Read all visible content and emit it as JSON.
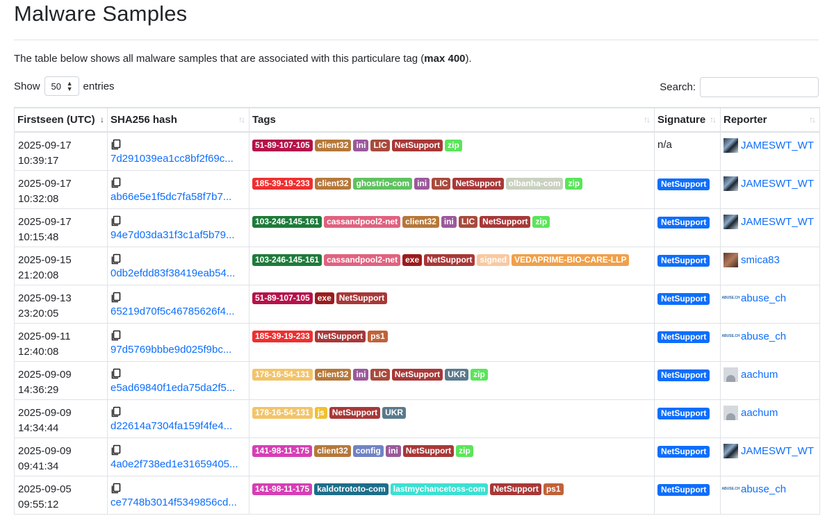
{
  "page": {
    "title": "Malware Samples",
    "intro_prefix": "The table below shows all malware samples that are associated with this particulare tag (",
    "intro_bold": "max 400",
    "intro_suffix": ")."
  },
  "controls": {
    "show_label": "Show",
    "entries_value": "50",
    "entries_label": "entries",
    "search_label": "Search:",
    "search_value": ""
  },
  "table": {
    "headers": [
      "Firstseen (UTC)",
      "SHA256 hash",
      "Tags",
      "Signature",
      "Reporter"
    ],
    "rows": [
      {
        "date": "2025-09-17",
        "time": "10:39:17",
        "hash": "7d291039ea1cc8bf2f69c...",
        "tags": [
          {
            "label": "51-89-107-105",
            "color": "#b5124a"
          },
          {
            "label": "client32",
            "color": "#b6783a"
          },
          {
            "label": "ini",
            "color": "#9b599b"
          },
          {
            "label": "LIC",
            "color": "#a84b3c"
          },
          {
            "label": "NetSupport",
            "color": "#a83838"
          },
          {
            "label": "zip",
            "color": "#5ae55a"
          }
        ],
        "signature": "n/a",
        "reporter": "JAMESWT_WT",
        "avatar": "jamesswt"
      },
      {
        "date": "2025-09-17",
        "time": "10:32:08",
        "hash": "ab66e5e1f5dc7fa58f7b7...",
        "tags": [
          {
            "label": "185-39-19-233",
            "color": "#ef2f2f"
          },
          {
            "label": "client32",
            "color": "#b6783a"
          },
          {
            "label": "ghostrio-com",
            "color": "#5fc25f"
          },
          {
            "label": "ini",
            "color": "#9b599b"
          },
          {
            "label": "LIC",
            "color": "#a84b3c"
          },
          {
            "label": "NetSupport",
            "color": "#a83838"
          },
          {
            "label": "olbanha-com",
            "color": "#c9d1c0"
          },
          {
            "label": "zip",
            "color": "#5ae55a"
          }
        ],
        "signature": "NetSupport",
        "reporter": "JAMESWT_WT",
        "avatar": "jamesswt"
      },
      {
        "date": "2025-09-17",
        "time": "10:15:48",
        "hash": "94e7d03da31f3c1af5b79...",
        "tags": [
          {
            "label": "103-246-145-161",
            "color": "#1e7b3b"
          },
          {
            "label": "cassandpool2-net",
            "color": "#e0627f"
          },
          {
            "label": "client32",
            "color": "#b6783a"
          },
          {
            "label": "ini",
            "color": "#9b599b"
          },
          {
            "label": "LIC",
            "color": "#a84b3c"
          },
          {
            "label": "NetSupport",
            "color": "#a83838"
          },
          {
            "label": "zip",
            "color": "#5ae55a"
          }
        ],
        "signature": "NetSupport",
        "reporter": "JAMESWT_WT",
        "avatar": "jamesswt"
      },
      {
        "date": "2025-09-15",
        "time": "21:20:08",
        "hash": "0db2efdd83f38419eab54...",
        "tags": [
          {
            "label": "103-246-145-161",
            "color": "#1e7b3b"
          },
          {
            "label": "cassandpool2-net",
            "color": "#e0627f"
          },
          {
            "label": "exe",
            "color": "#9b1c1c"
          },
          {
            "label": "NetSupport",
            "color": "#a83838"
          },
          {
            "label": "signed",
            "color": "#f8c9a0"
          },
          {
            "label": "VEDAPRIME-BIO-CARE-LLP",
            "color": "#f0a04a"
          }
        ],
        "signature": "NetSupport",
        "reporter": "smica83",
        "avatar": "smica"
      },
      {
        "date": "2025-09-13",
        "time": "23:20:05",
        "hash": "65219d70f5c46785626f4...",
        "tags": [
          {
            "label": "51-89-107-105",
            "color": "#b5124a"
          },
          {
            "label": "exe",
            "color": "#9b1c1c"
          },
          {
            "label": "NetSupport",
            "color": "#a83838"
          }
        ],
        "signature": "NetSupport",
        "reporter": "abuse_ch",
        "avatar": "abuse"
      },
      {
        "date": "2025-09-11",
        "time": "12:40:08",
        "hash": "97d5769bbbe9d025f9bc...",
        "tags": [
          {
            "label": "185-39-19-233",
            "color": "#ef2f2f"
          },
          {
            "label": "NetSupport",
            "color": "#a83838"
          },
          {
            "label": "ps1",
            "color": "#c0623a"
          }
        ],
        "signature": "NetSupport",
        "reporter": "abuse_ch",
        "avatar": "abuse"
      },
      {
        "date": "2025-09-09",
        "time": "14:36:29",
        "hash": "e5ad69840f1eda75da2f5...",
        "tags": [
          {
            "label": "178-16-54-131",
            "color": "#f2c46a"
          },
          {
            "label": "client32",
            "color": "#b6783a"
          },
          {
            "label": "ini",
            "color": "#9b599b"
          },
          {
            "label": "LIC",
            "color": "#a84b3c"
          },
          {
            "label": "NetSupport",
            "color": "#a83838"
          },
          {
            "label": "UKR",
            "color": "#5a7a8c"
          },
          {
            "label": "zip",
            "color": "#5ae55a"
          }
        ],
        "signature": "NetSupport",
        "reporter": "aachum",
        "avatar": "aachum"
      },
      {
        "date": "2025-09-09",
        "time": "14:34:44",
        "hash": "d22614a7304fa159f4fe4...",
        "tags": [
          {
            "label": "178-16-54-131",
            "color": "#f2c46a"
          },
          {
            "label": "js",
            "color": "#f0c030"
          },
          {
            "label": "NetSupport",
            "color": "#a83838"
          },
          {
            "label": "UKR",
            "color": "#5a7a8c"
          }
        ],
        "signature": "NetSupport",
        "reporter": "aachum",
        "avatar": "aachum"
      },
      {
        "date": "2025-09-09",
        "time": "09:41:34",
        "hash": "4a0e2f738ed1e31659405...",
        "tags": [
          {
            "label": "141-98-11-175",
            "color": "#d63fb5"
          },
          {
            "label": "client32",
            "color": "#b6783a"
          },
          {
            "label": "config",
            "color": "#7084c4"
          },
          {
            "label": "ini",
            "color": "#9b599b"
          },
          {
            "label": "NetSupport",
            "color": "#a83838"
          },
          {
            "label": "zip",
            "color": "#5ae55a"
          }
        ],
        "signature": "NetSupport",
        "reporter": "JAMESWT_WT",
        "avatar": "jamesswt"
      },
      {
        "date": "2025-09-05",
        "time": "09:55:12",
        "hash": "ce7748b3014f5349856cd...",
        "tags": [
          {
            "label": "141-98-11-175",
            "color": "#d63fb5"
          },
          {
            "label": "kaldotrototo-com",
            "color": "#1c6e8a"
          },
          {
            "label": "lastmychancetoss-com",
            "color": "#3ce0d2"
          },
          {
            "label": "NetSupport",
            "color": "#a83838"
          },
          {
            "label": "ps1",
            "color": "#c0623a"
          }
        ],
        "signature": "NetSupport",
        "reporter": "abuse_ch",
        "avatar": "abuse"
      }
    ]
  }
}
